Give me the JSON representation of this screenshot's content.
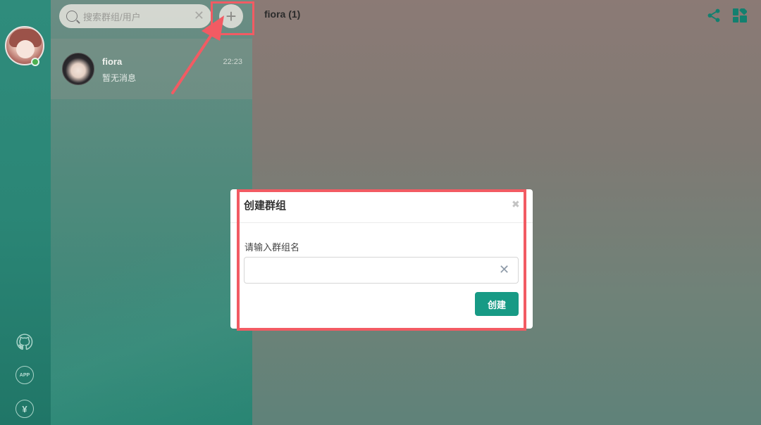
{
  "sidebar": {
    "icons": [
      "github-icon",
      "app-icon",
      "yen-icon"
    ],
    "app_label": "APP",
    "yen_label": "¥"
  },
  "search": {
    "placeholder": "搜索群组/用户",
    "clear_glyph": "✕",
    "add_glyph": "+"
  },
  "conversations": [
    {
      "name": "fiora",
      "time": "22:23",
      "preview": "暂无消息"
    }
  ],
  "chat": {
    "title": "fiora (1)"
  },
  "modal": {
    "title": "创建群组",
    "close_glyph": "✖",
    "field_label": "请输入群组名",
    "input_value": "",
    "input_clear_glyph": "✕",
    "create_label": "创建"
  },
  "colors": {
    "accent": "#179a85",
    "highlight": "#f25b63",
    "online": "#4caf50"
  }
}
